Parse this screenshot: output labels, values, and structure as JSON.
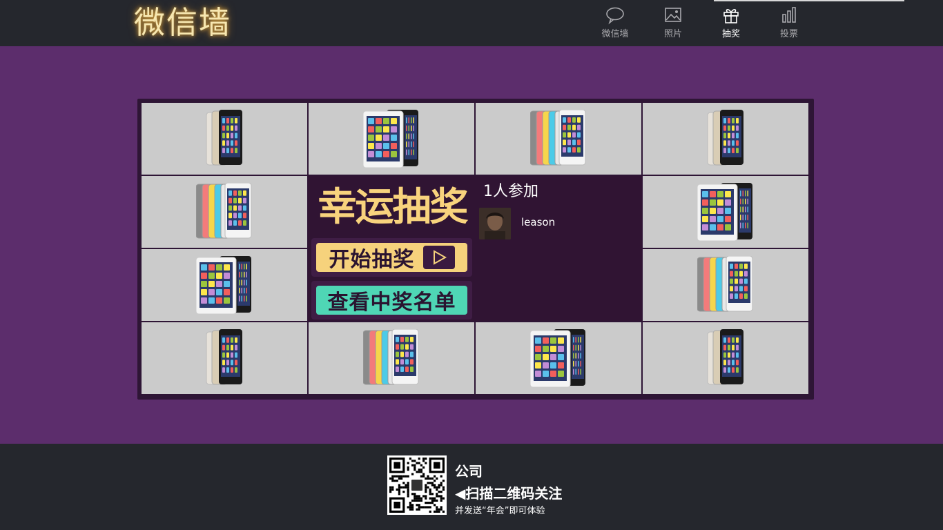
{
  "header": {
    "logo_text": "微信墙",
    "nav": [
      {
        "label": "微信墙",
        "icon": "chat-bubble-icon",
        "active": false
      },
      {
        "label": "照片",
        "icon": "image-icon",
        "active": false
      },
      {
        "label": "抽奖",
        "icon": "gift-icon",
        "active": true
      },
      {
        "label": "投票",
        "icon": "bar-chart-icon",
        "active": false
      }
    ]
  },
  "lottery": {
    "title": "幸运抽奖",
    "start_button": "开始抽奖",
    "winners_button": "查看中奖名单",
    "participants_label": "1人参加",
    "participants": [
      {
        "name": "leason",
        "avatar": "avatar-photo"
      }
    ]
  },
  "prizes": [
    {
      "product": "iphone-5s"
    },
    {
      "product": "ipad-mini"
    },
    {
      "product": "ipod-touch"
    },
    {
      "product": "iphone-5s"
    },
    {
      "product": "ipod-touch"
    },
    {
      "product": "ipad-mini"
    },
    {
      "product": "ipad-mini"
    },
    {
      "product": "ipod-touch"
    },
    {
      "product": "iphone-5s"
    },
    {
      "product": "ipod-touch"
    },
    {
      "product": "ipad-mini"
    },
    {
      "product": "iphone-5s"
    }
  ],
  "footer": {
    "company": "公司",
    "scan_text": "◀扫描二维码关注",
    "send_text": "并发送“年会”即可体验"
  },
  "colors": {
    "page_bg": "#5c2d6c",
    "bar_bg": "#25272d",
    "cell_bg": "#cbcbcb",
    "panel_bg": "#301433",
    "title_gold": "#f8d37d",
    "start_btn": "#f6d27c",
    "list_btn": "#4fd6b5"
  }
}
